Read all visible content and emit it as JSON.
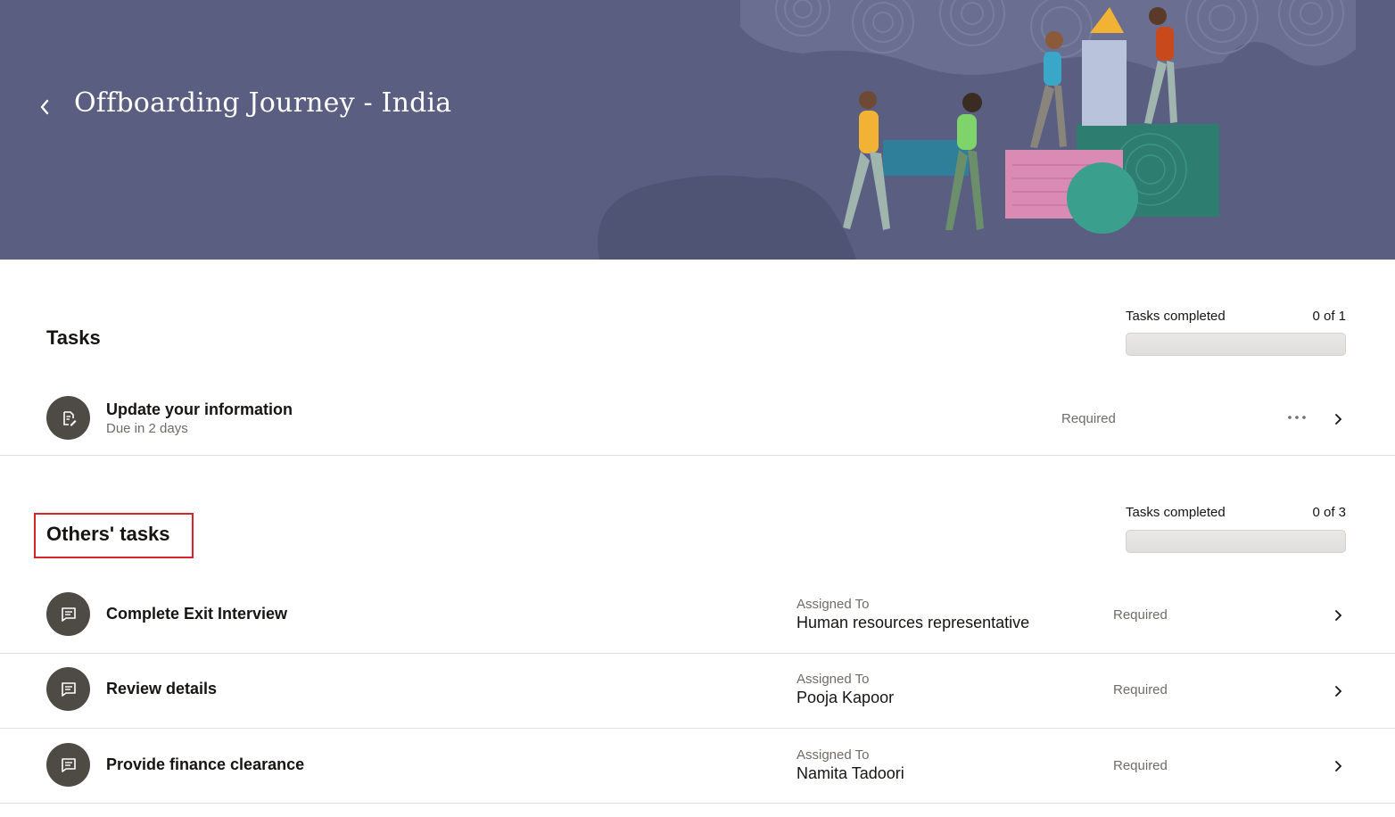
{
  "header": {
    "title": "Offboarding Journey - India",
    "back_icon": "chevron-left-icon",
    "background_color": "#5a5f82"
  },
  "my_tasks": {
    "title": "Tasks",
    "progress_label": "Tasks completed",
    "progress_count": "0 of 1",
    "progress_fraction": 0,
    "items": [
      {
        "name": "Update your information",
        "subtitle": "Due in 2 days",
        "status": "Required",
        "icon": "edit-document-icon",
        "has_more": true
      }
    ]
  },
  "others_tasks": {
    "title": "Others' tasks",
    "progress_label": "Tasks completed",
    "progress_count": "0 of 3",
    "progress_fraction": 0,
    "assigned_label": "Assigned To",
    "items": [
      {
        "name": "Complete Exit Interview",
        "assigned_to": "Human resources representative",
        "status": "Required",
        "icon": "chat-bubble-icon"
      },
      {
        "name": "Review details",
        "assigned_to": "Pooja Kapoor",
        "status": "Required",
        "icon": "chat-bubble-icon"
      },
      {
        "name": "Provide finance clearance",
        "assigned_to": "Namita Tadoori",
        "status": "Required",
        "icon": "chat-bubble-icon"
      }
    ]
  },
  "colors": {
    "highlight": "#d6222a",
    "avatar": "#4e4a44",
    "progress_fill": "#227e9e"
  }
}
